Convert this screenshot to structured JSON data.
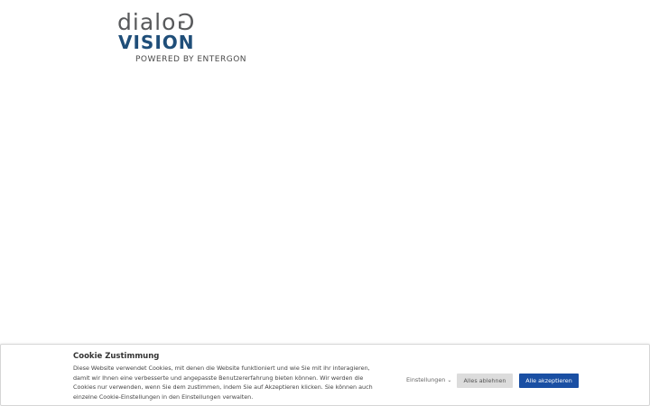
{
  "logo": {
    "line1_main": "dialo",
    "line1_flipped": "G",
    "line2": "VISION",
    "tagline": "POWERED BY ENTERGON"
  },
  "cookie": {
    "title": "Cookie Zustimmung",
    "text": "Diese Website verwendet Cookies, mit denen die Website funktioniert und wie Sie mit ihr interagieren, damit wir Ihnen eine verbesserte und angepasste Benutzererfahrung bieten können. Wir werden die Cookies nur verwenden, wenn Sie dem zustimmen, indem Sie auf Akzeptieren klicken. Sie können auch einzelne Cookie-Einstellungen in den Einstellungen verwalten.",
    "settings_label": "Einstellungen",
    "settings_icon": "chevron-down-icon",
    "reject_label": "Alles ablehnen",
    "accept_label": "Alle akzeptieren"
  },
  "colors": {
    "logo_gray": "#58595b",
    "logo_blue": "#1f4e79",
    "accept_bg": "#1a4fa3",
    "reject_bg": "#dcdcdc"
  }
}
